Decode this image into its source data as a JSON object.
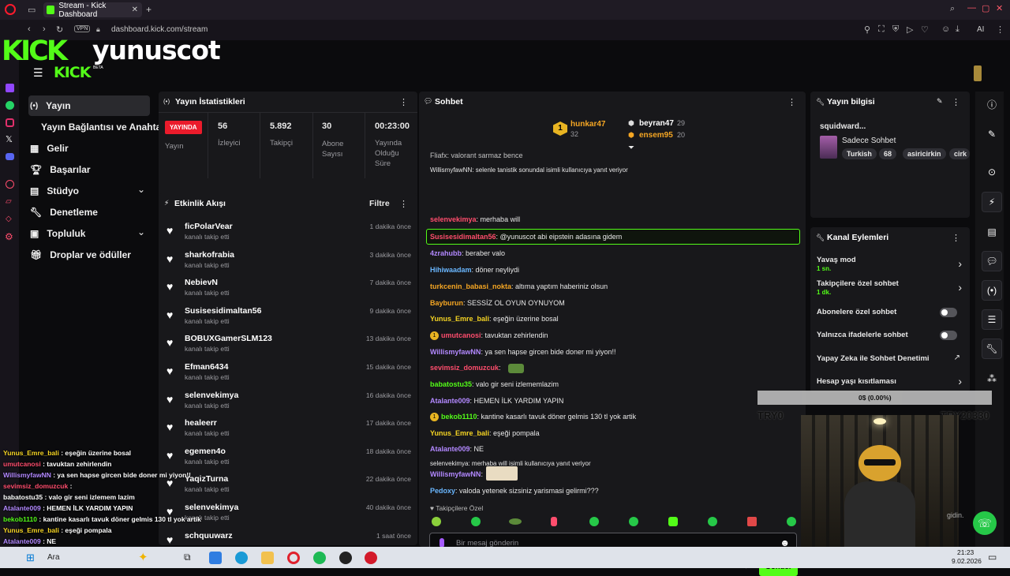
{
  "browser": {
    "tab_title": "Stream - Kick Dashboard",
    "new_tab": "+",
    "url": "dashboard.kick.com/stream",
    "vpn": "VPN",
    "ai_label": "AI"
  },
  "brand": {
    "overlay_logo": "KICK",
    "overlay_username": "yunuscot",
    "header_logo": "KICK",
    "beta": "BETA"
  },
  "sidebar": {
    "items": [
      {
        "label": "Yayın",
        "icon": "broadcast-icon"
      },
      {
        "label": "Yayın Bağlantısı ve Anahtarı",
        "icon": "none"
      },
      {
        "label": "Gelir",
        "icon": "chart-icon"
      },
      {
        "label": "Başarılar",
        "icon": "trophy-icon"
      },
      {
        "label": "Stüdyo",
        "icon": "studio-icon"
      },
      {
        "label": "Denetleme",
        "icon": "wrench-icon"
      },
      {
        "label": "Topluluk",
        "icon": "community-icon"
      },
      {
        "label": "Droplar ve ödüller",
        "icon": "gift-icon"
      }
    ]
  },
  "stats": {
    "title": "Yayın İstatistikleri",
    "live_badge": "YAYINDA",
    "live_label": "Yayın",
    "viewers_value": "56",
    "viewers_label": "İzleyici",
    "followers_value": "5.892",
    "followers_label": "Takipçi",
    "subs_value": "30",
    "subs_label": "Abone Sayısı",
    "uptime_value": "00:23:00",
    "uptime_label": "Yayında Olduğu Süre"
  },
  "activity": {
    "title": "Etkinlik Akışı",
    "filter": "Filtre",
    "items": [
      {
        "name": "ficPolarVear",
        "action": "kanalı takip etti",
        "time": "1 dakika önce"
      },
      {
        "name": "sharkofrabia",
        "action": "kanalı takip etti",
        "time": "3 dakika önce"
      },
      {
        "name": "NebievN",
        "action": "kanalı takip etti",
        "time": "7 dakika önce"
      },
      {
        "name": "Susisesidimaltan56",
        "action": "kanalı takip etti",
        "time": "9 dakika önce"
      },
      {
        "name": "BOBUXGamerSLM123",
        "action": "kanalı takip etti",
        "time": "13 dakika önce"
      },
      {
        "name": "Efman6434",
        "action": "kanalı takip etti",
        "time": "15 dakika önce"
      },
      {
        "name": "selenvekimya",
        "action": "kanalı takip etti",
        "time": "16 dakika önce"
      },
      {
        "name": "healeerr",
        "action": "kanalı takip etti",
        "time": "17 dakika önce"
      },
      {
        "name": "egemen4o",
        "action": "kanalı takip etti",
        "time": "18 dakika önce"
      },
      {
        "name": "YaqizTurna",
        "action": "kanalı takip etti",
        "time": "22 dakika önce"
      },
      {
        "name": "selenvekimya",
        "action": "kanalı takip etti",
        "time": "40 dakika önce"
      },
      {
        "name": "schquuwarz",
        "action": "",
        "time": "1 saat önce"
      }
    ]
  },
  "chat": {
    "title": "Sohbet",
    "top_gifters": [
      {
        "rank": "1",
        "name": "hunkar47",
        "count": "32"
      },
      {
        "rank": "",
        "name": "beyran47",
        "count": "29"
      },
      {
        "rank": "",
        "name": "ensem95",
        "count": "20"
      }
    ],
    "cut_line": "Fliafx: valorant sarmaz bence",
    "reply_1": "WillismyfawNN: selenle tanistik sonundal isimli kullanıcıya yanıt veriyor",
    "reply_2": "selenvekimya: merhaba will isimli kullanıcıya yanıt veriyor",
    "messages": [
      {
        "user": "selenvekimya",
        "color": "#ff4d6d",
        "text": ": merhaba will",
        "badge": ""
      },
      {
        "user": "Susisesidimaltan56",
        "color": "#ff4d6d",
        "text": ": @yunuscot abi eipstein adasına gidem",
        "badge": "",
        "highlight": true
      },
      {
        "user": "4zrahubb",
        "color": "#b288ff",
        "text": ": beraber valo",
        "badge": ""
      },
      {
        "user": "Hihiwaadam",
        "color": "#6ab7ff",
        "text": ": döner neyliydi",
        "badge": ""
      },
      {
        "user": "turkcenin_babasi_nokta",
        "color": "#f5a623",
        "text": ": altıma yaptım haberiniz olsun",
        "badge": ""
      },
      {
        "user": "Bayburun",
        "color": "#f5a623",
        "text": ": SESSİZ OL OYUN OYNUYOM",
        "badge": ""
      },
      {
        "user": "Yunus_Emre_bali",
        "color": "#f5d423",
        "text": ": eşeğin üzerine bosal",
        "badge": ""
      },
      {
        "user": "umutcanosi",
        "color": "#ff4d6d",
        "text": ": tavuktan zehirlendin",
        "badge": "1"
      },
      {
        "user": "WillismyfawNN",
        "color": "#b288ff",
        "text": ": ya sen hapse gircen bide doner mi yiyon!!",
        "badge": ""
      },
      {
        "user": "sevimsiz_domuzcuk",
        "color": "#ff4d6d",
        "text": ":",
        "badge": ""
      },
      {
        "user": "babatostu35",
        "color": "#53fc18",
        "text": ": valo gir seni izlememlazim",
        "badge": ""
      },
      {
        "user": "Atalante009",
        "color": "#b288ff",
        "text": ": HEMEN İLK YARDIM YAPIN",
        "badge": ""
      },
      {
        "user": "bekob1110",
        "color": "#53fc18",
        "text": ": kantine kasarlı tavuk döner gelmis 130 tl yok artik",
        "badge": "1"
      },
      {
        "user": "Yunus_Emre_bali",
        "color": "#f5d423",
        "text": ": eşeği pompala",
        "badge": ""
      },
      {
        "user": "Atalante009",
        "color": "#b288ff",
        "text": ": NE",
        "badge": ""
      },
      {
        "user": "WillismyfawNN",
        "color": "#b288ff",
        "text": ":",
        "badge": ""
      },
      {
        "user": "Pedoxy",
        "color": "#6ab7ff",
        "text": ": valoda yetenek sizsiniz yarismasi gelirmi???",
        "badge": ""
      }
    ],
    "followers_only": "Takipçilere Özel",
    "placeholder": "Bir mesaj gönderin",
    "points": "0",
    "send": "Gönder"
  },
  "stream_info": {
    "title": "Yayın bilgisi",
    "stream_title": "squidward...",
    "category": "Sadece Sohbet",
    "tags": [
      "Turkish",
      "68",
      "asiricirkin",
      "cirk"
    ]
  },
  "channel_actions": {
    "title": "Kanal Eylemleri",
    "items": [
      {
        "label": "Yavaş mod",
        "sub": "1 sn.",
        "control": "chevron"
      },
      {
        "label": "Takipçilere özel sohbet",
        "sub": "1 dk.",
        "control": "chevron"
      },
      {
        "label": "Abonelere özel sohbet",
        "sub": "",
        "control": "toggle"
      },
      {
        "label": "Yalnızca ifadelerle sohbet",
        "sub": "",
        "control": "toggle"
      },
      {
        "label": "Yapay Zeka ile Sohbet Denetimi",
        "sub": "",
        "control": "external"
      },
      {
        "label": "Hesap yaşı kısıtlaması",
        "sub": "",
        "control": "chevron"
      }
    ]
  },
  "goal_overlay": {
    "progress_text": "0$ (0.00%)",
    "left": "TRY0",
    "right": "TRY20330"
  },
  "overlay_chat": [
    {
      "user": "Yunus_Emre_bali",
      "color": "#f5d423",
      "text": " : eşeğin üzerine bosal"
    },
    {
      "user": "umutcanosi",
      "color": "#ff4d6d",
      "text": " : tavuktan zehirlendin"
    },
    {
      "user": "WillismyfawNN",
      "color": "#b288ff",
      "text": " : ya sen hapse gircen bide doner mi yiyon!!"
    },
    {
      "user": "sevimsiz_domuzcuk",
      "color": "#ff4d6d",
      "text": " :"
    },
    {
      "user": "babatostu35",
      "color": "#fff",
      "text": " : valo gir seni izlemem lazim"
    },
    {
      "user": "Atalante009",
      "color": "#b288ff",
      "text": " : HEMEN İLK YARDIM YAPIN"
    },
    {
      "user": "bekob1110",
      "color": "#53fc18",
      "text": " : kantine kasarlı tavuk döner gelmis 130 tl yok artik"
    },
    {
      "user": "Yunus_Emre_bali",
      "color": "#f5d423",
      "text": " : eşeği pompala"
    },
    {
      "user": "Atalante009",
      "color": "#b288ff",
      "text": " : NE"
    }
  ],
  "webcam_text": "gidin.",
  "taskbar": {
    "search": "Ara",
    "time": "21:23",
    "date": "9.02.2026"
  }
}
